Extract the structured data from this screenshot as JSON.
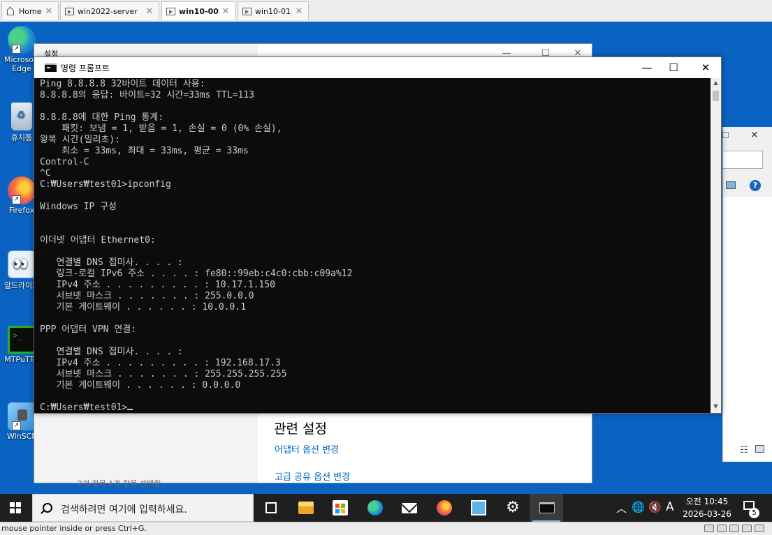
{
  "vm_tabs": [
    {
      "label": "Home",
      "icon": "home-icon"
    },
    {
      "label": "win2022-server",
      "icon": "vm-icon"
    },
    {
      "label": "win10-00",
      "icon": "vm-icon",
      "active": true
    },
    {
      "label": "win10-01",
      "icon": "vm-icon"
    }
  ],
  "desktop_icons": [
    {
      "label": "Microsoft Edge",
      "icon": "edge-icon"
    },
    {
      "label": "휴지통",
      "icon": "recycle-bin-icon"
    },
    {
      "label": "Firefox",
      "icon": "firefox-icon"
    },
    {
      "label": "알드라이브",
      "icon": "aldrive-icon"
    },
    {
      "label": "MTPuTTY",
      "icon": "terminal-icon"
    },
    {
      "label": "WinSCP",
      "icon": "winscp-icon"
    }
  ],
  "settings_window": {
    "title": "설정",
    "related_title": "관련 설정",
    "links": [
      "어댑터 옵션 변경",
      "고급 공유 옵션 변경"
    ],
    "status": "2개 항목    1개 항목 선택함"
  },
  "cmd_window": {
    "title": "명령 프롬프트",
    "lines": [
      "Ping 8.8.8.8 32바이트 데이터 사용:",
      "8.8.8.8의 응답: 바이트=32 시간=33ms TTL=113",
      "",
      "8.8.8.8에 대한 Ping 통계:",
      "    패킷: 보냄 = 1, 받음 = 1, 손실 = 0 (0% 손실),",
      "왕복 시간(밀리초):",
      "    최소 = 33ms, 최대 = 33ms, 평균 = 33ms",
      "Control-C",
      "^C",
      "C:₩Users₩test01>ipconfig",
      "",
      "Windows IP 구성",
      "",
      "",
      "이더넷 어댑터 Ethernet0:",
      "",
      "   연결별 DNS 접미사. . . . :",
      "   링크-로컬 IPv6 주소 . . . . : fe80::99eb:c4c0:cbb:c09a%12",
      "   IPv4 주소 . . . . . . . . . : 10.17.1.150",
      "   서브넷 마스크 . . . . . . . : 255.0.0.0",
      "   기본 게이트웨이 . . . . . . : 10.0.0.1",
      "",
      "PPP 어댑터 VPN 연결:",
      "",
      "   연결별 DNS 접미사. . . . :",
      "   IPv4 주소 . . . . . . . . . : 192.168.17.3",
      "   서브넷 마스크 . . . . . . . : 255.255.255.255",
      "   기본 게이트웨이 . . . . . . : 0.0.0.0",
      "",
      "C:₩Users₩test01>"
    ]
  },
  "taskbar": {
    "search_placeholder": "검색하려면 여기에 입력하세요.",
    "apps": [
      "task-view-icon",
      "file-explorer-icon",
      "store-icon",
      "edge-icon",
      "mail-icon",
      "firefox-icon",
      "network-app-icon",
      "settings-icon",
      "cmd-icon"
    ],
    "ime": "A",
    "time": "오전 10:45",
    "date": "2026-03-26",
    "notification_count": "5"
  },
  "vm_status": {
    "message": "mouse pointer inside or press Ctrl+G."
  },
  "colors": {
    "desktop": "#0a63c2",
    "console_bg": "#0c0c0c",
    "console_text": "#cccccc",
    "link": "#0067c0",
    "taskbar": "#1f1f1f"
  }
}
